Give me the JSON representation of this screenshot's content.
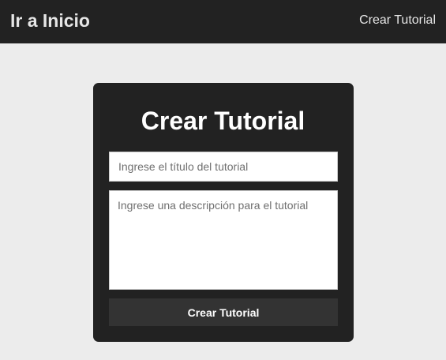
{
  "navbar": {
    "brand_label": "Ir a Inicio",
    "link_label": "Crear Tutorial"
  },
  "form": {
    "title": "Crear Tutorial",
    "title_input": {
      "value": "",
      "placeholder": "Ingrese el título del tutorial"
    },
    "description_input": {
      "value": "",
      "placeholder": "Ingrese una descripción para el tutorial"
    },
    "submit_label": "Crear Tutorial"
  },
  "colors": {
    "navbar_bg": "#222222",
    "page_bg": "#ececec",
    "card_bg": "#222222",
    "button_bg": "#333333",
    "text_light": "#ffffff"
  }
}
